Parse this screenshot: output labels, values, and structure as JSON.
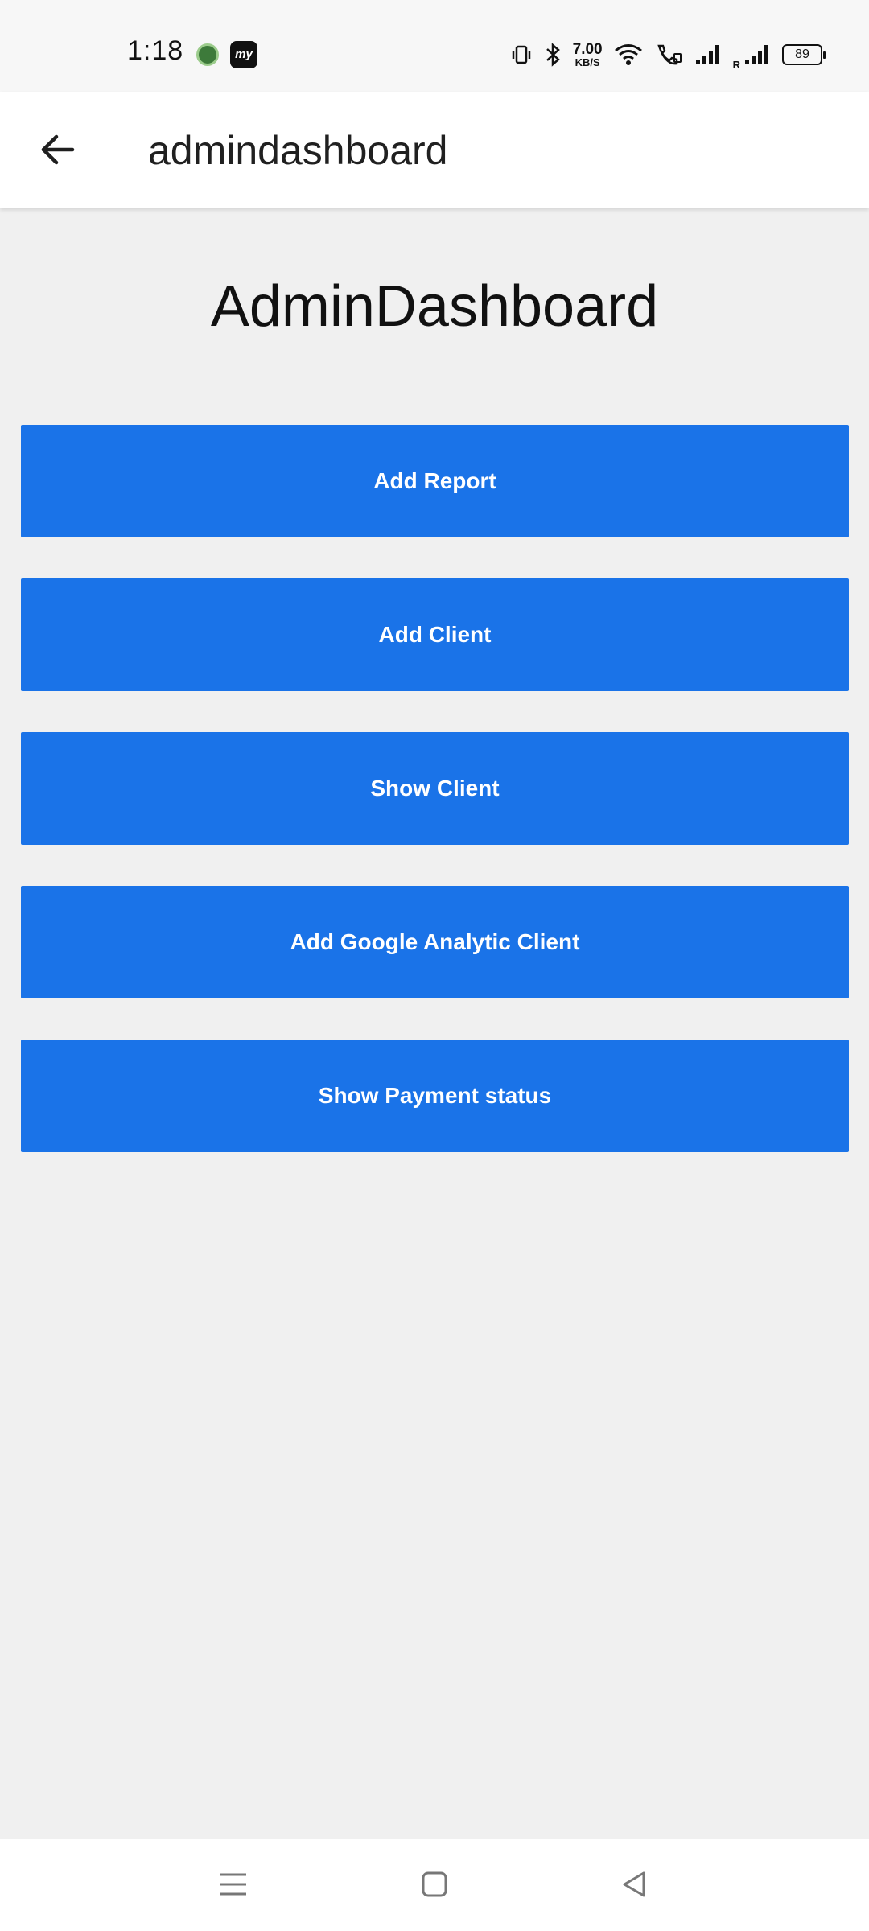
{
  "status_bar": {
    "time": "1:18",
    "app_badge": "my",
    "net_speed_value": "7.00",
    "net_speed_unit": "KB/S",
    "roaming_label": "R",
    "battery": "89"
  },
  "app_bar": {
    "title": "admindashboard",
    "back_icon": "arrow-left-icon"
  },
  "main": {
    "heading": "AdminDashboard",
    "buttons": [
      {
        "label": "Add Report"
      },
      {
        "label": "Add Client"
      },
      {
        "label": "Show Client"
      },
      {
        "label": "Add Google Analytic Client"
      },
      {
        "label": "Show Payment status"
      }
    ]
  },
  "nav_bar": {
    "icons": [
      "menu-icon",
      "home-icon",
      "back-triangle-icon"
    ]
  },
  "colors": {
    "button_bg": "#1a73e8",
    "page_bg": "#f0f0f0",
    "app_bar_bg": "#ffffff"
  }
}
